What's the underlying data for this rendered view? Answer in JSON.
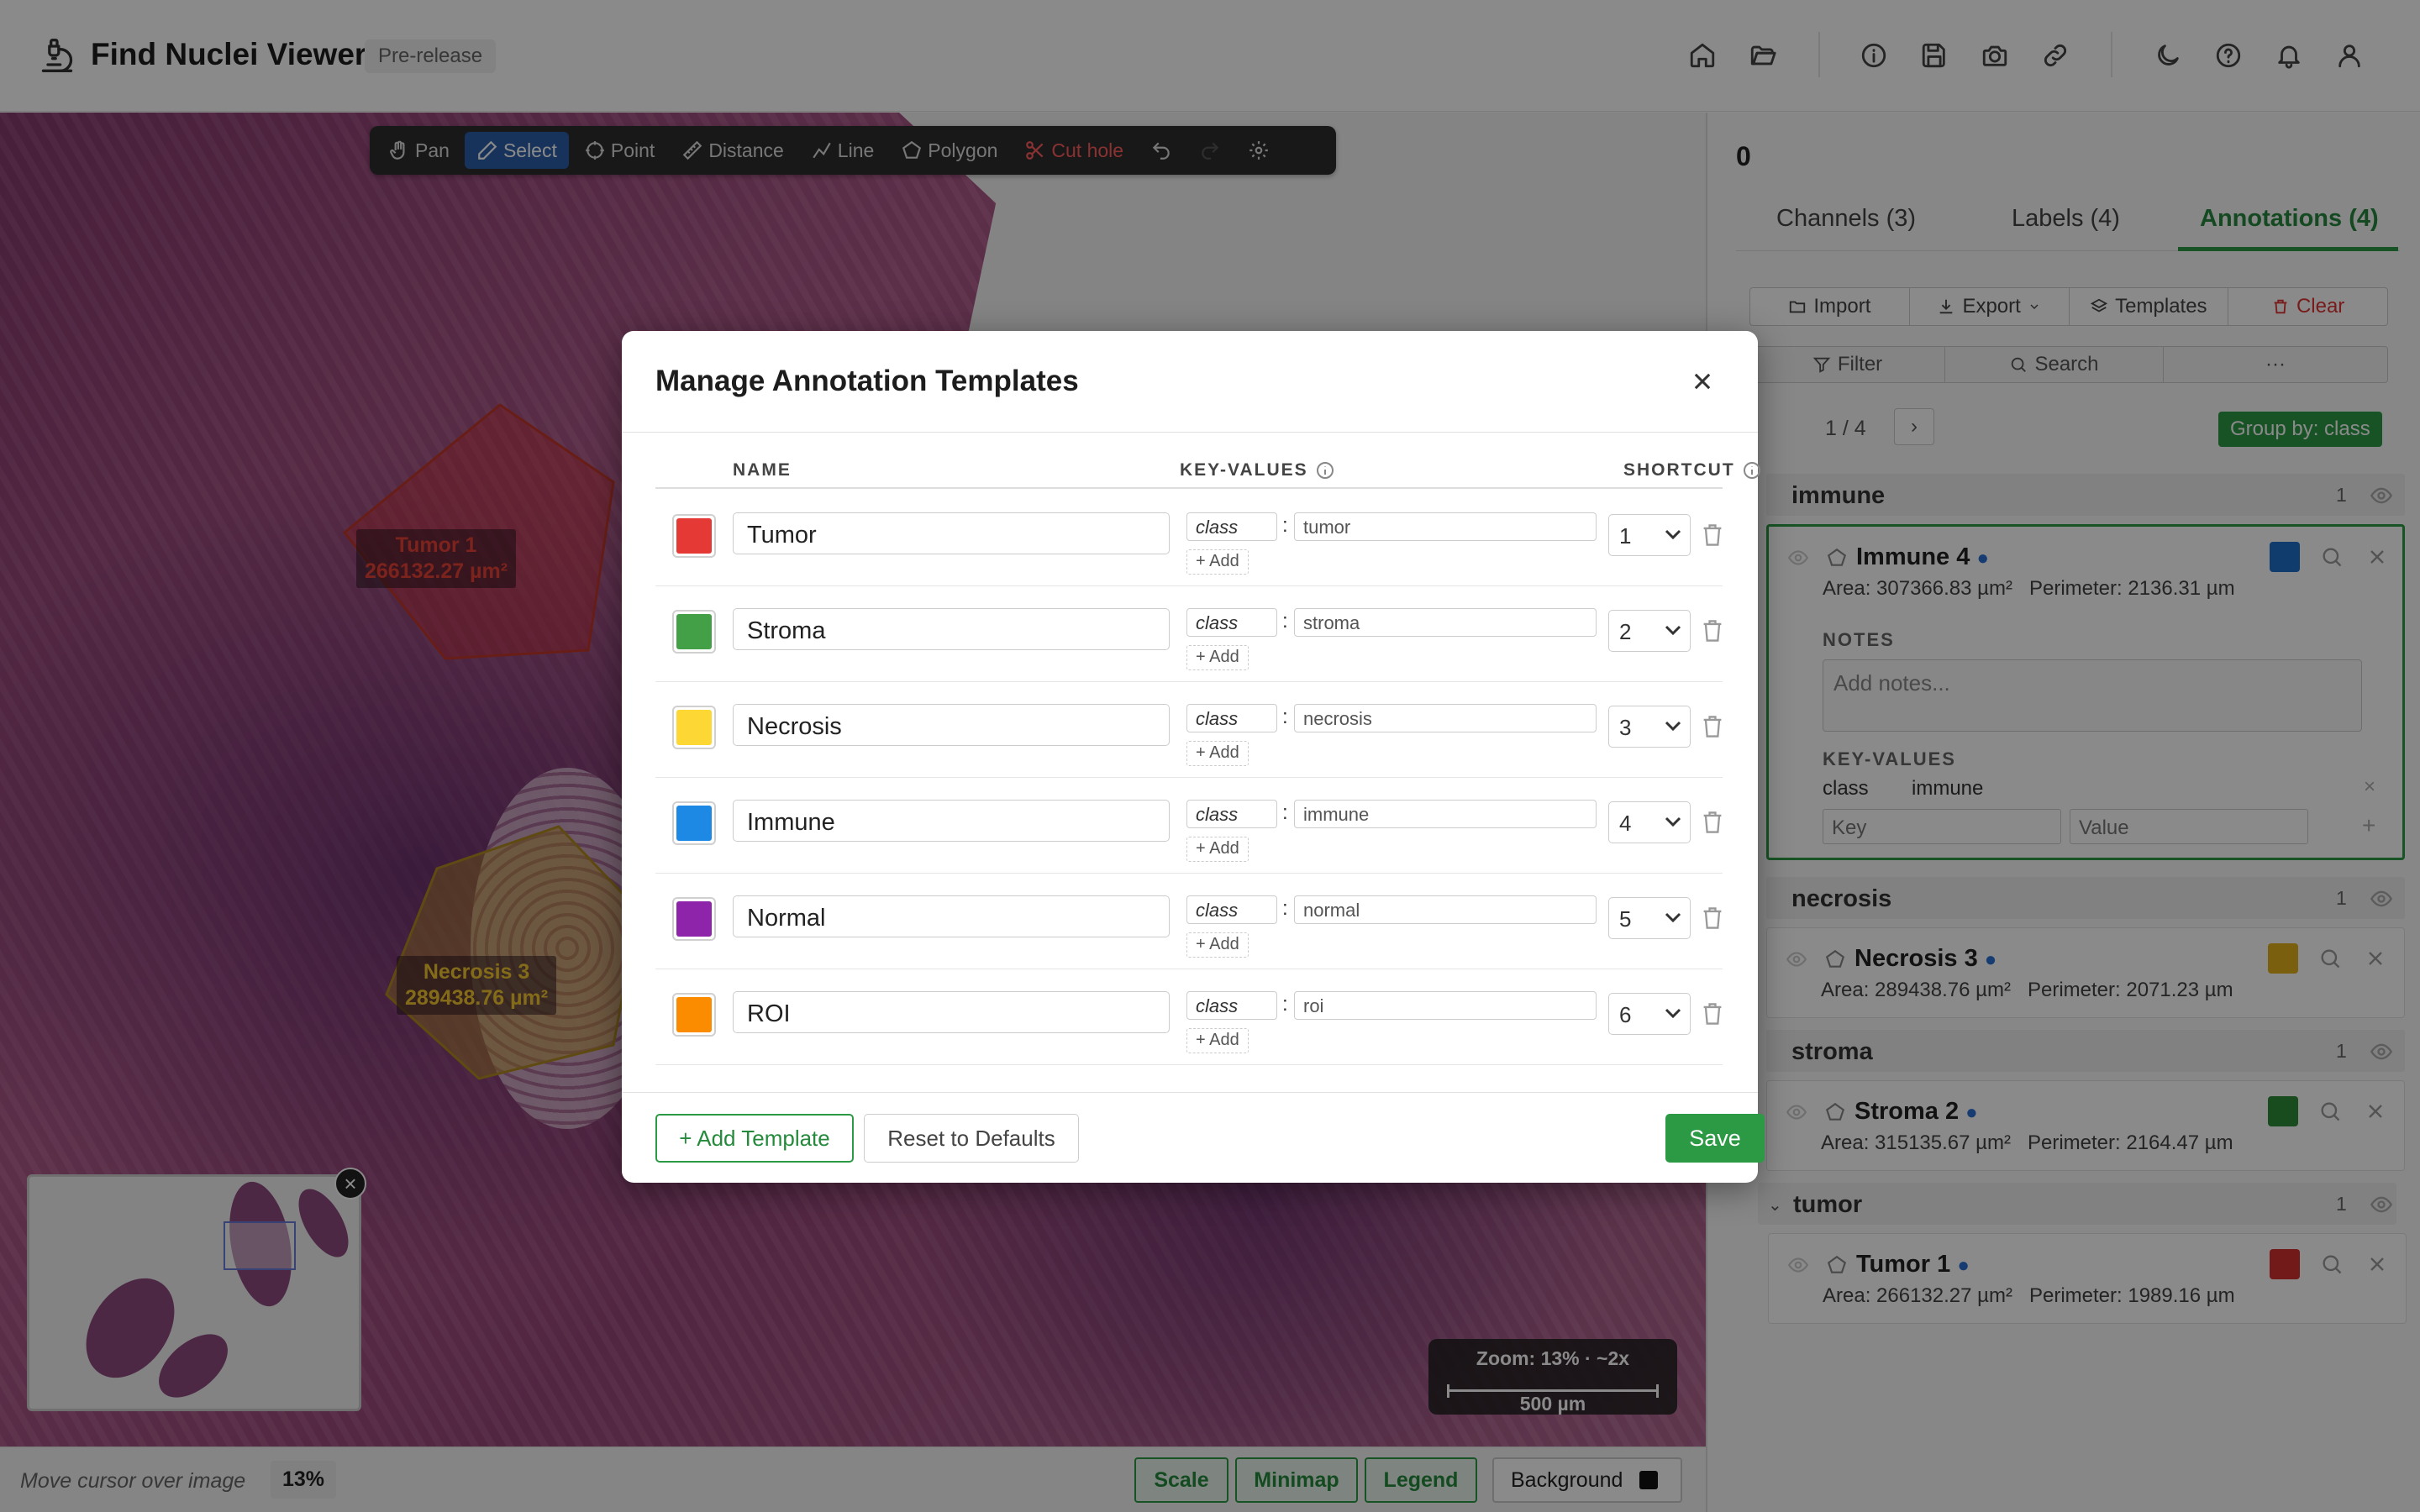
{
  "header": {
    "title": "Find Nuclei Viewer",
    "badge": "Pre-release",
    "icons": [
      "home-icon",
      "folder-open-icon",
      "info-icon",
      "save-icon",
      "camera-icon",
      "link-icon",
      "moon-icon",
      "help-icon",
      "bell-icon",
      "user-icon"
    ]
  },
  "toolbar": {
    "pan": "Pan",
    "select": "Select",
    "point": "Point",
    "distance": "Distance",
    "line": "Line",
    "polygon": "Polygon",
    "cut_hole": "Cut hole"
  },
  "viewer": {
    "annotation_labels": {
      "tumor": {
        "name": "Tumor 1",
        "area": "266132.27 µm²"
      },
      "necrosis": {
        "name": "Necrosis 3",
        "area": "289438.76 µm²"
      }
    },
    "zoom_text": "Zoom: 13% · ~2x",
    "scale_text": "500 µm"
  },
  "status": {
    "cursor": "Move cursor over image",
    "zoom": "13%",
    "scale": "Scale",
    "minimap": "Minimap",
    "legend": "Legend",
    "background": "Background"
  },
  "panel": {
    "count": "0",
    "tabs": [
      "Channels (3)",
      "Labels (4)",
      "Annotations (4)"
    ],
    "actions": {
      "import": "Import",
      "export": "Export",
      "templates": "Templates",
      "clear": "Clear"
    },
    "filter": "Filter",
    "search": "Search",
    "more": "···",
    "pager": "1 / 4",
    "pager_next": "›",
    "group_by": "Group by: class",
    "groups": [
      {
        "name": "immune",
        "count": "1"
      },
      {
        "name": "necrosis",
        "count": "1"
      },
      {
        "name": "stroma",
        "count": "1"
      },
      {
        "name": "tumor",
        "count": "1"
      }
    ],
    "items": [
      {
        "name": "Immune 4",
        "area": "Area: 307366.83 µm²",
        "perimeter": "Perimeter: 2136.31 µm",
        "color": "#1e6fc9"
      },
      {
        "name": "Necrosis 3",
        "area": "Area: 289438.76 µm²",
        "perimeter": "Perimeter: 2071.23 µm",
        "color": "#e0b01a"
      },
      {
        "name": "Stroma 2",
        "area": "Area: 315135.67 µm²",
        "perimeter": "Perimeter: 2164.47 µm",
        "color": "#2e8c3a"
      },
      {
        "name": "Tumor 1",
        "area": "Area: 266132.27 µm²",
        "perimeter": "Perimeter: 1989.16 µm",
        "color": "#d32f2f"
      }
    ],
    "selected": {
      "notes_label": "NOTES",
      "notes_placeholder": "Add notes...",
      "kv_label": "KEY-VALUES",
      "kv_key": "class",
      "kv_value": "immune",
      "key_placeholder": "Key",
      "value_placeholder": "Value"
    }
  },
  "modal": {
    "title": "Manage Annotation Templates",
    "col_name": "NAME",
    "col_kv": "KEY-VALUES",
    "col_shortcut": "SHORTCUT",
    "add_label": "+ Add",
    "templates": [
      {
        "name": "Tumor",
        "key": "class",
        "value": "tumor",
        "shortcut": "1",
        "color": "#e53935"
      },
      {
        "name": "Stroma",
        "key": "class",
        "value": "stroma",
        "shortcut": "2",
        "color": "#43a047"
      },
      {
        "name": "Necrosis",
        "key": "class",
        "value": "necrosis",
        "shortcut": "3",
        "color": "#fdd835"
      },
      {
        "name": "Immune",
        "key": "class",
        "value": "immune",
        "shortcut": "4",
        "color": "#1e88e5"
      },
      {
        "name": "Normal",
        "key": "class",
        "value": "normal",
        "shortcut": "5",
        "color": "#8e24aa"
      },
      {
        "name": "ROI",
        "key": "class",
        "value": "roi",
        "shortcut": "6",
        "color": "#fb8c00"
      }
    ],
    "add_template": "+ Add Template",
    "reset": "Reset to Defaults",
    "save": "Save"
  }
}
